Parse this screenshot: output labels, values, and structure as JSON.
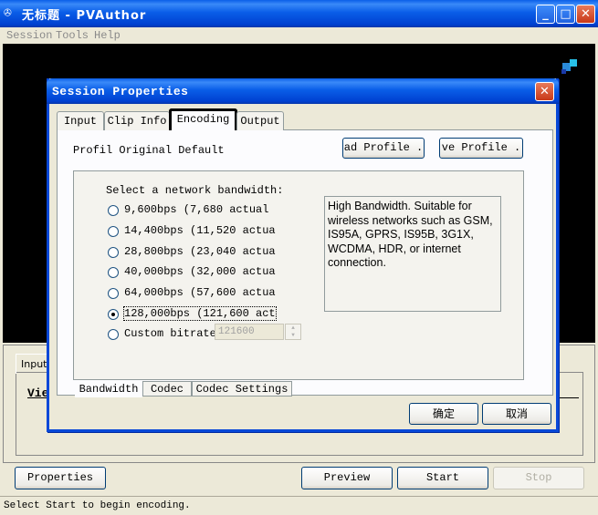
{
  "window": {
    "icon_glyph": "✇",
    "title": "无标题 - PVAuthor",
    "minimize_glyph": "_",
    "maximize_glyph": "□",
    "close_glyph": "✕"
  },
  "menu": {
    "items": [
      {
        "label": "Session",
        "underline": "S"
      },
      {
        "label": "Tools",
        "underline": "T"
      },
      {
        "label": "Help",
        "underline": "H"
      }
    ]
  },
  "background_panel": {
    "tab_label": "Input",
    "visible_text": "Vie"
  },
  "bottom_buttons": {
    "properties": "Properties",
    "preview": "Preview",
    "start": "Start",
    "stop": "Stop"
  },
  "status": {
    "text": "Select Start to begin encoding."
  },
  "dialog": {
    "title": "Session Properties",
    "close_glyph": "✕",
    "tabs": [
      "Input",
      "Clip Info",
      "Encoding",
      "Output"
    ],
    "active_tab": "Encoding",
    "profile_label": "Profil Original Default",
    "load_profile_button": "ad Profile .",
    "save_profile_button": "ve Profile .",
    "bandwidth": {
      "heading": "Select a network bandwidth:",
      "options": [
        "9,600bps (7,680 actual",
        "14,400bps (11,520 actua",
        "28,800bps (23,040 actua",
        "40,000bps (32,000 actua",
        "64,000bps (57,600 actua",
        "128,000bps (121,600 act"
      ],
      "selected_index": 5,
      "custom_label": "Custom bitrate",
      "custom_value": "121600",
      "description": "High Bandwidth.  Suitable for wireless networks such as GSM, IS95A, GPRS, IS95B, 3G1X, WCDMA, HDR, or internet connection."
    },
    "subtabs": [
      "Bandwidth",
      "Codec",
      "Codec Settings"
    ],
    "active_subtab": "Bandwidth",
    "ok_button": "确定",
    "cancel_button": "取消"
  },
  "colors": {
    "titlebar_blue": "#0a5ee8",
    "face": "#ece9d8",
    "preview_bg": "#000000"
  }
}
